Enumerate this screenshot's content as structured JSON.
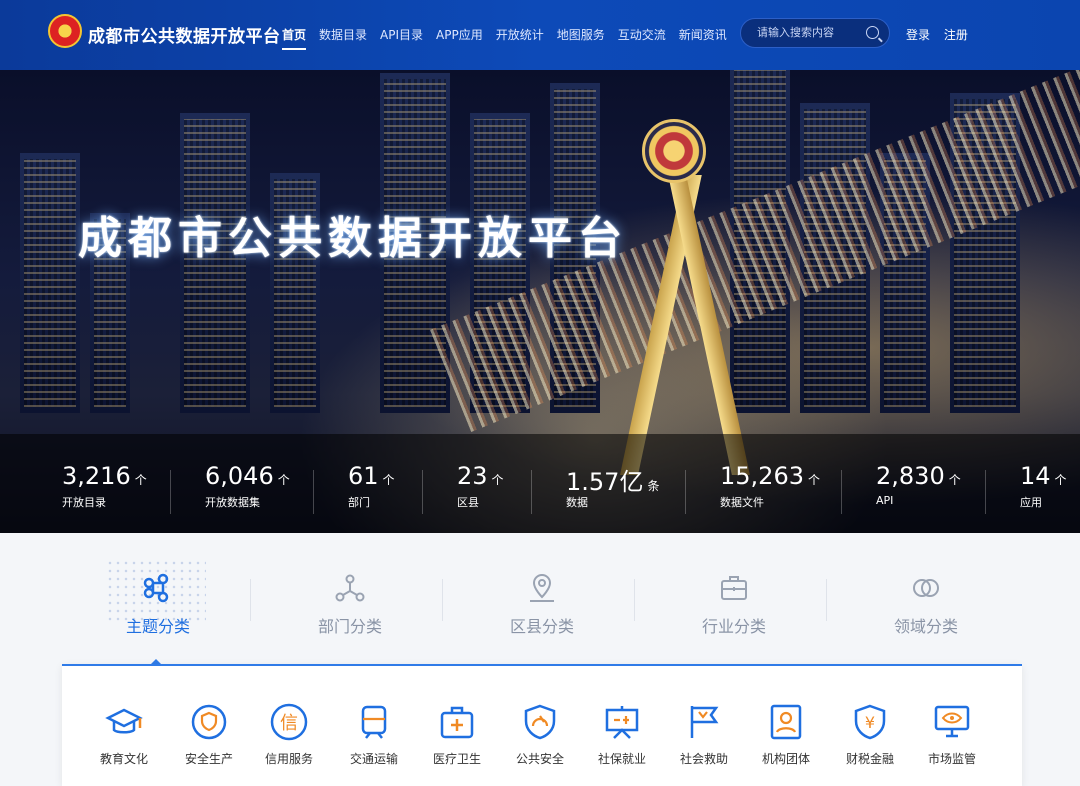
{
  "header": {
    "site_title": "成都市公共数据开放平台",
    "nav": [
      "首页",
      "数据目录",
      "API目录",
      "APP应用",
      "开放统计",
      "地图服务",
      "互动交流",
      "新闻资讯"
    ],
    "search_placeholder": "请输入搜索内容",
    "login": "登录",
    "register": "注册"
  },
  "hero": {
    "title": "成都市公共数据开放平台",
    "stats": [
      {
        "value": "3,216",
        "unit": "个",
        "label": "开放目录"
      },
      {
        "value": "6,046",
        "unit": "个",
        "label": "开放数据集"
      },
      {
        "value": "61",
        "unit": "个",
        "label": "部门"
      },
      {
        "value": "23",
        "unit": "个",
        "label": "区县"
      },
      {
        "value": "1.57亿",
        "unit": "条",
        "label": "数据"
      },
      {
        "value": "15,263",
        "unit": "个",
        "label": "数据文件"
      },
      {
        "value": "2,830",
        "unit": "个",
        "label": "API"
      },
      {
        "value": "14",
        "unit": "个",
        "label": "应用"
      }
    ]
  },
  "categories": {
    "tabs": [
      "主题分类",
      "部门分类",
      "区县分类",
      "行业分类",
      "领域分类"
    ],
    "active": "主题分类",
    "topics": [
      "教育文化",
      "安全生产",
      "信用服务",
      "交通运输",
      "医疗卫生",
      "公共安全",
      "社保就业",
      "社会救助",
      "机构团体",
      "财税金融",
      "市场监管"
    ]
  },
  "colors": {
    "header": "#0d4ab8",
    "accent": "#1f6fe0"
  }
}
